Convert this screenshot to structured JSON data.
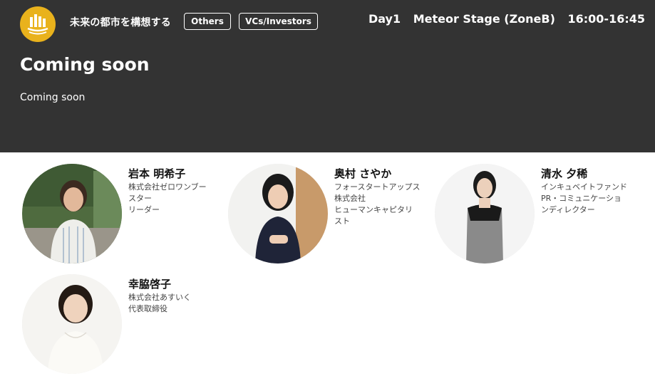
{
  "header": {
    "logo_icon": "city-logo-icon",
    "category": "未来の都市を構想する",
    "tags": [
      "Others",
      "VCs/Investors"
    ],
    "day": "Day1",
    "stage": "Meteor Stage (ZoneB)",
    "time": "16:00-16:45",
    "title": "Coming soon",
    "description": "Coming soon"
  },
  "colors": {
    "header_bg": "#333333",
    "logo_bg": "#e9b21c",
    "text_dark": "#111111"
  },
  "speakers": [
    {
      "name": "岩本 明希子",
      "affiliation": [
        "株式会社ゼロワンブー",
        "スター",
        "リーダー"
      ]
    },
    {
      "name": "奥村 さやか",
      "affiliation": [
        "フォースタートアップス",
        "株式会社",
        "ヒューマンキャピタリ",
        "スト"
      ]
    },
    {
      "name": "清水 夕稀",
      "affiliation": [
        "インキュベイトファンド",
        "PR・コミュニケーショ",
        "ンディレクター"
      ]
    },
    {
      "name": "幸脇啓子",
      "affiliation": [
        "株式会社あすいく",
        "代表取締役"
      ]
    }
  ]
}
